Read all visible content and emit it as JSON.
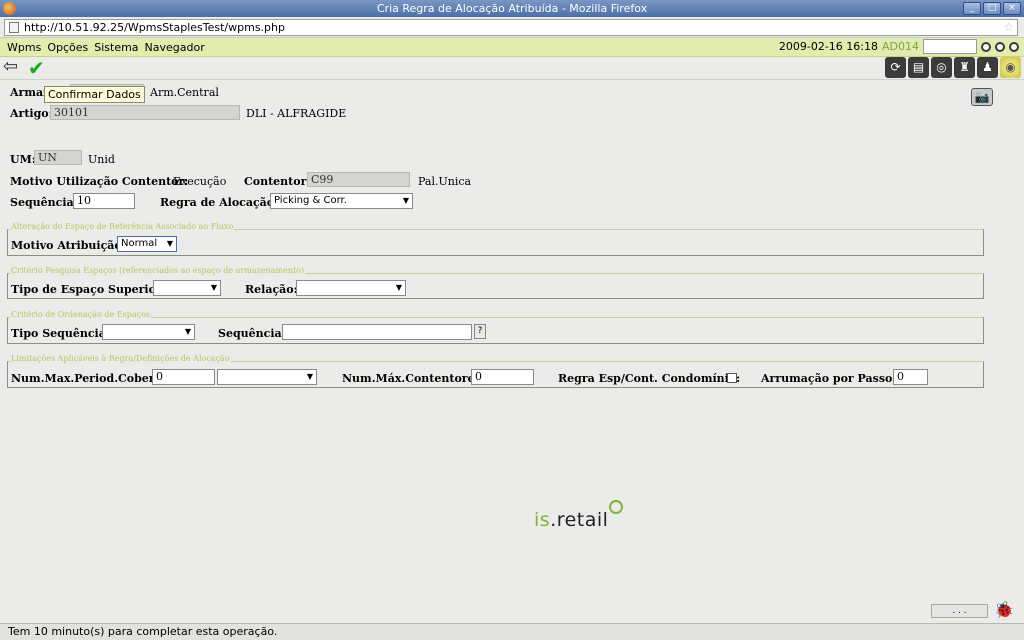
{
  "window": {
    "title": "Cria Regra de Alocação Atribuída - Mozilla Firefox"
  },
  "browser": {
    "url": "http://10.51.92.25/WpmsStaplesTest/wpms.php"
  },
  "menu": {
    "items": [
      "Wpms",
      "Opções",
      "Sistema",
      "Navegador"
    ],
    "datetime": "2009-02-16 16:18",
    "user": "AD014"
  },
  "tooltip": "Confirmar Dados",
  "form": {
    "armazem_label": "Armaz",
    "armazem_value": "Arm.Central",
    "artigo_label": "Artigo:",
    "artigo_code": "30101",
    "artigo_desc": "DLI - ALFRAGIDE",
    "um_label": "UM:",
    "um_value": "UN",
    "um_desc": "Unid",
    "motivo_util_label": "Motivo Utilização Contentor:",
    "motivo_util_value": "Execução",
    "contentor_label": "Contentor:",
    "contentor_value": "C99",
    "contentor_desc": "Pal.Unica",
    "sequencia_label": "Sequência:",
    "sequencia_value": "10",
    "regra_label": "Regra de Alocação:",
    "regra_value": "Picking & Corr."
  },
  "fieldsets": {
    "alteracao": {
      "legend": "Alteração do Espaço de Referência Associado ao Fluxo",
      "motivo_label": "Motivo Atribuição:",
      "motivo_value": "Normal"
    },
    "criterio_pesquisa": {
      "legend": "Critério Pesquisa Espaços (referenciados ao espaço de armazenamento)",
      "tipo_label": "Tipo de Espaço Superior:",
      "tipo_value": "",
      "relacao_label": "Relação:",
      "relacao_value": ""
    },
    "criterio_ordenacao": {
      "legend": "Critério de Ordenação de Espaços",
      "tipo_seq_label": "Tipo Sequência:",
      "tipo_seq_value": "",
      "sequencia_label": "Sequência:",
      "sequencia_value": "",
      "help_label": "?"
    },
    "limitacoes": {
      "legend": "Limitações Aplicáveis à Regra/Definições de Alocação",
      "num_max_period_label": "Num.Max.Period.Cobert.:",
      "num_max_period_value": "0",
      "num_max_period_unit": "",
      "num_max_cont_label": "Num.Máx.Contentores:",
      "num_max_cont_value": "0",
      "regra_esp_label": "Regra Esp/Cont. Condomínio:",
      "regra_esp_checked": false,
      "arrumacao_label": "Arrumação por Passos:",
      "arrumacao_value": "0"
    }
  },
  "logo": {
    "prefix": "is",
    "suffix": ".retail"
  },
  "bottom_button": ". . .",
  "status": "Tem 10 minuto(s) para completar esta operação.",
  "colors": {
    "menubar": "#e2ecae",
    "legend": "#b5c75a",
    "brand": "#7fb33a"
  }
}
